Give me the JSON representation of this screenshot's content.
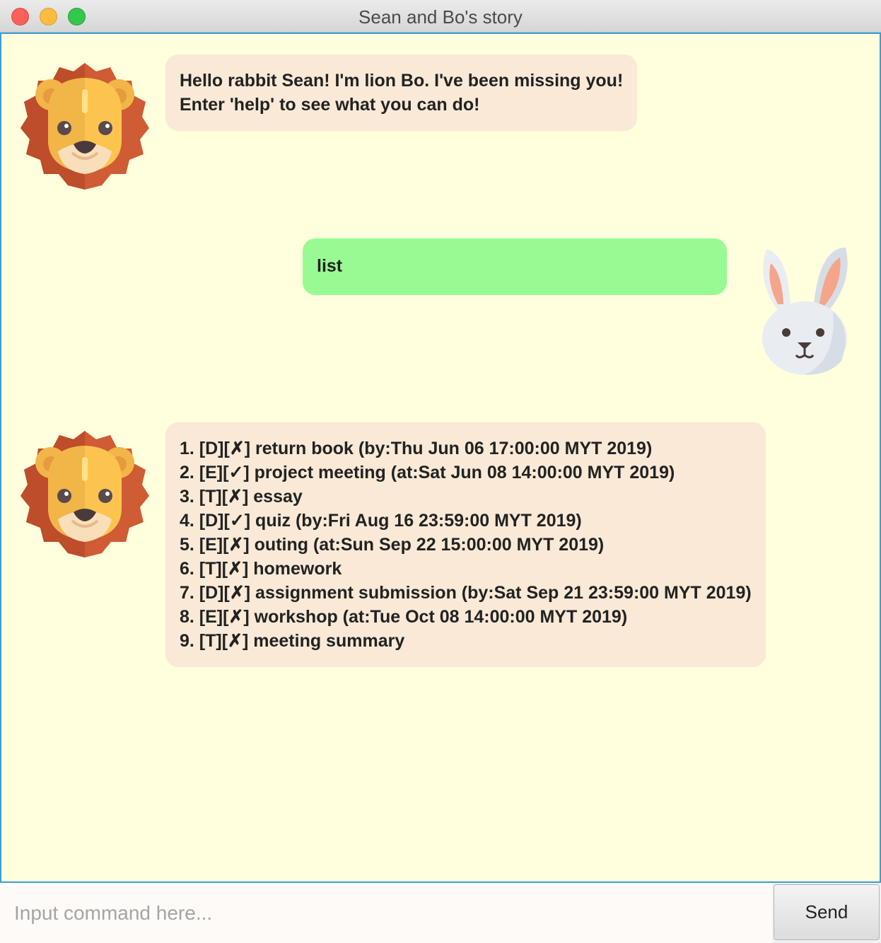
{
  "window": {
    "title": "Sean and Bo's story"
  },
  "messages": [
    {
      "sender": "bot",
      "avatar_icon": "lion-icon",
      "lines": [
        "Hello rabbit Sean! I'm lion Bo. I've been missing you!",
        "Enter 'help' to see what you can do!"
      ]
    },
    {
      "sender": "user",
      "avatar_icon": "rabbit-icon",
      "lines": [
        "list"
      ]
    },
    {
      "sender": "bot",
      "avatar_icon": "lion-icon",
      "lines": [
        "1. [D][✗] return book (by:Thu Jun 06 17:00:00 MYT 2019)",
        "2. [E][✓] project meeting (at:Sat Jun 08 14:00:00 MYT 2019)",
        "3. [T][✗] essay",
        "4. [D][✓] quiz (by:Fri Aug 16 23:59:00 MYT 2019)",
        "5. [E][✗] outing (at:Sun Sep 22 15:00:00 MYT 2019)",
        "6. [T][✗] homework",
        "7. [D][✗] assignment submission (by:Sat Sep 21 23:59:00 MYT 2019)",
        "8. [E][✗] workshop (at:Tue Oct 08 14:00:00 MYT 2019)",
        "9. [T][✗] meeting summary"
      ]
    }
  ],
  "input": {
    "placeholder": "Input command here...",
    "value": ""
  },
  "send_button": {
    "label": "Send"
  },
  "colors": {
    "chat_background": "#ffffdd",
    "bot_bubble": "#f9e9d6",
    "user_bubble": "#98fa93",
    "chat_border": "#3a9fd6"
  }
}
